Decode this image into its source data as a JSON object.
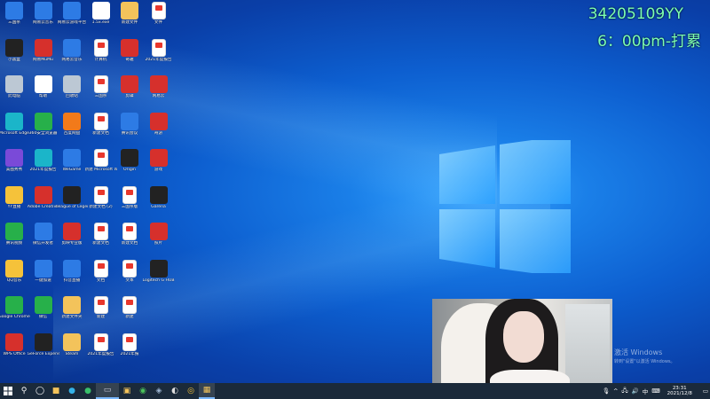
{
  "overlay": {
    "line1": "34205109YY",
    "line2": "6：00pm-打累"
  },
  "desktop_icons": [
    {
      "label": "三国杀",
      "color": "#2d7be5",
      "kind": "blue"
    },
    {
      "label": "小黑盒",
      "color": "#222222",
      "kind": "dark"
    },
    {
      "label": "此电脑",
      "color": "#bcc8d4",
      "kind": "grey"
    },
    {
      "label": "Microsoft Edge",
      "color": "#1bb5c9",
      "kind": "teal"
    },
    {
      "label": "美图秀秀",
      "color": "#7a4ad8",
      "kind": "purple"
    },
    {
      "label": "YY直播",
      "color": "#f5c23a",
      "kind": "yellow"
    },
    {
      "label": "腾讯视频",
      "color": "#27b04a",
      "kind": "green"
    },
    {
      "label": "QQ音乐",
      "color": "#f5c23a",
      "kind": "yellow"
    },
    {
      "label": "Google Chrome",
      "color": "#27b04a",
      "kind": "green"
    },
    {
      "label": "WPS Office",
      "color": "#d6302c",
      "kind": "red"
    },
    {
      "label": "网易云音乐",
      "color": "#2d7be5",
      "kind": "blue"
    },
    {
      "label": "网易MuMu",
      "color": "#d6302c",
      "kind": "red"
    },
    {
      "label": "帮助",
      "color": "#ffffff",
      "kind": "white"
    },
    {
      "label": "360安全浏览器",
      "color": "#27b04a",
      "kind": "green"
    },
    {
      "label": "2021年度报告",
      "color": "#1bb5c9",
      "kind": "teal"
    },
    {
      "label": "Adobe Creative",
      "color": "#d6302c",
      "kind": "red"
    },
    {
      "label": "微信开发者",
      "color": "#2d7be5",
      "kind": "blue"
    },
    {
      "label": "一键加速",
      "color": "#2d7be5",
      "kind": "blue"
    },
    {
      "label": "微信",
      "color": "#27b04a",
      "kind": "green"
    },
    {
      "label": "GeForce Experience",
      "color": "#222222",
      "kind": "dark"
    },
    {
      "label": "网易云游戏平台",
      "color": "#2d7be5",
      "kind": "blue"
    },
    {
      "label": "网易云音乐",
      "color": "#2d7be5",
      "kind": "blue"
    },
    {
      "label": "回收站",
      "color": "#bcc8d4",
      "kind": "grey"
    },
    {
      "label": "百度网盘",
      "color": "#f27a1a",
      "kind": "orange"
    },
    {
      "label": "WeGame",
      "color": "#2d7be5",
      "kind": "blue"
    },
    {
      "label": "League of Legends",
      "color": "#222222",
      "kind": "dark"
    },
    {
      "label": "剪映专业版",
      "color": "#d6302c",
      "kind": "red"
    },
    {
      "label": "抖音直播",
      "color": "#2d7be5",
      "kind": "blue"
    },
    {
      "label": "新建文件夹",
      "color": "#f3c35b",
      "kind": "folder"
    },
    {
      "label": "Steam",
      "color": "#f3c35b",
      "kind": "folder"
    },
    {
      "label": "1.5x.exe",
      "color": "#ffffff",
      "kind": "white"
    },
    {
      "label": "计算机",
      "color": "#ffffff",
      "kind": "pdf"
    },
    {
      "label": "三国杀",
      "color": "#ffffff",
      "kind": "pdf"
    },
    {
      "label": "新建文档",
      "color": "#ffffff",
      "kind": "pdf"
    },
    {
      "label": "新建 Microsoft Word",
      "color": "#ffffff",
      "kind": "pdf"
    },
    {
      "label": "新建文档 (2)",
      "color": "#ffffff",
      "kind": "pdf"
    },
    {
      "label": "新建文档",
      "color": "#ffffff",
      "kind": "pdf"
    },
    {
      "label": "文档",
      "color": "#ffffff",
      "kind": "pdf"
    },
    {
      "label": "新建",
      "color": "#ffffff",
      "kind": "pdf"
    },
    {
      "label": "2021年度报告",
      "color": "#ffffff",
      "kind": "pdf"
    },
    {
      "label": "新建文件",
      "color": "#f3c35b",
      "kind": "folder"
    },
    {
      "label": "奇趣",
      "color": "#d6302c",
      "kind": "red"
    },
    {
      "label": "剪辑",
      "color": "#d6302c",
      "kind": "red"
    },
    {
      "label": "腾讯会议",
      "color": "#2d7be5",
      "kind": "blue"
    },
    {
      "label": "Origin",
      "color": "#222222",
      "kind": "dark"
    },
    {
      "label": "三国杀版",
      "color": "#ffffff",
      "kind": "pdf"
    },
    {
      "label": "新建文档",
      "color": "#ffffff",
      "kind": "pdf"
    },
    {
      "label": "文本",
      "color": "#ffffff",
      "kind": "pdf"
    },
    {
      "label": "新建",
      "color": "#ffffff",
      "kind": "pdf"
    },
    {
      "label": "2021年报",
      "color": "#ffffff",
      "kind": "pdf"
    },
    {
      "label": "文件",
      "color": "#ffffff",
      "kind": "pdf"
    },
    {
      "label": "2021年度报告",
      "color": "#ffffff",
      "kind": "pdf"
    },
    {
      "label": "网易云",
      "color": "#d6302c",
      "kind": "red"
    },
    {
      "label": "奇游",
      "color": "#d6302c",
      "kind": "red"
    },
    {
      "label": "游戏",
      "color": "#d6302c",
      "kind": "red"
    },
    {
      "label": "Garena",
      "color": "#222222",
      "kind": "dark"
    },
    {
      "label": "照片",
      "color": "#d6302c",
      "kind": "red"
    },
    {
      "label": "Logitech G HUB",
      "color": "#222222",
      "kind": "dark"
    }
  ],
  "webcam": {
    "activation_line1": "激活 Windows",
    "activation_line2": "转到\"设置\"以激活 Windows。"
  },
  "taskbar": {
    "start_icon": "windows-logo-icon",
    "items": [
      "search-icon",
      "task-view-icon",
      "edge-icon",
      "chrome-icon",
      "file-explorer-icon",
      "game-icon",
      "steam-icon",
      "obs-icon",
      "folder-icon"
    ],
    "tray_icons": [
      "microphone-icon",
      "speaker-icon",
      "network-icon",
      "keyboard-icon",
      "ime-icon"
    ],
    "ime_label": "中",
    "clock_time": "23:31",
    "clock_date": "2021/12/8"
  }
}
